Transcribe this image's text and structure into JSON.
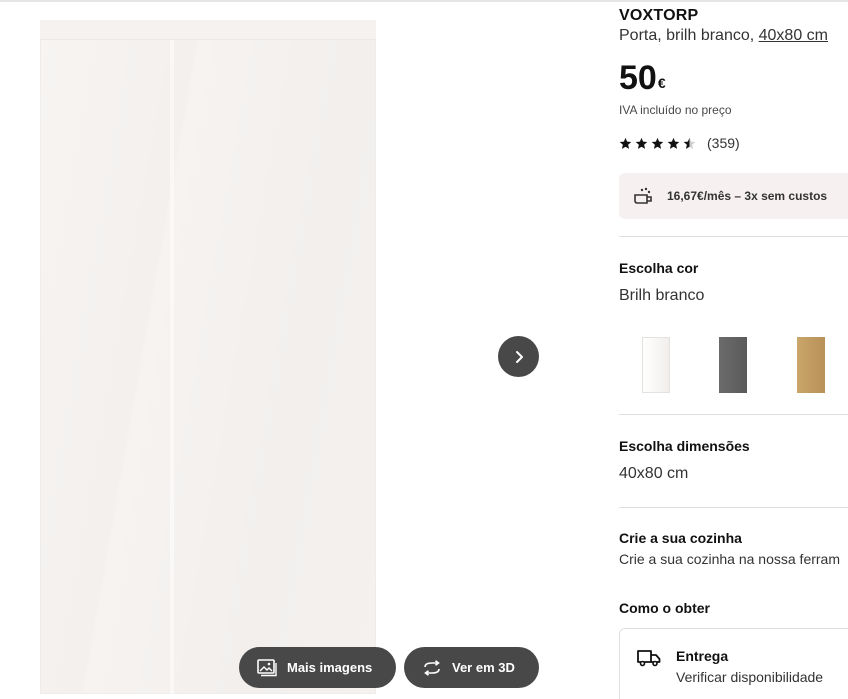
{
  "product": {
    "name": "VOXTORP",
    "description_prefix": "Porta, brilh branco, ",
    "dimension_link": "40x80 cm",
    "price_value": "50",
    "price_currency": "€",
    "vat_note": "IVA incluído no preço",
    "rating_value": 4.5,
    "rating_count": "(359)",
    "financing": "16,67€/mês – 3x sem custos"
  },
  "color": {
    "label": "Escolha cor",
    "selected": "Brilh branco",
    "swatches": [
      "white-gloss",
      "dark-grey",
      "oak"
    ]
  },
  "size": {
    "label": "Escolha dimensões",
    "selected": "40x80 cm"
  },
  "kitchen": {
    "title": "Crie a sua cozinha",
    "text": "Crie a sua cozinha na nossa ferram"
  },
  "delivery": {
    "section_title": "Como o obter",
    "title": "Entrega",
    "subtitle": "Verificar disponibilidade"
  },
  "gallery": {
    "more_images_label": "Mais imagens",
    "view_3d_label": "Ver em 3D"
  },
  "colors": {
    "button_bg": "#484848",
    "finance_bg": "#f7f0f0",
    "text": "#111111"
  },
  "icons": [
    "chevron-right-icon",
    "images-icon",
    "rotate-3d-icon",
    "payment-icon",
    "star-icon",
    "truck-icon"
  ]
}
